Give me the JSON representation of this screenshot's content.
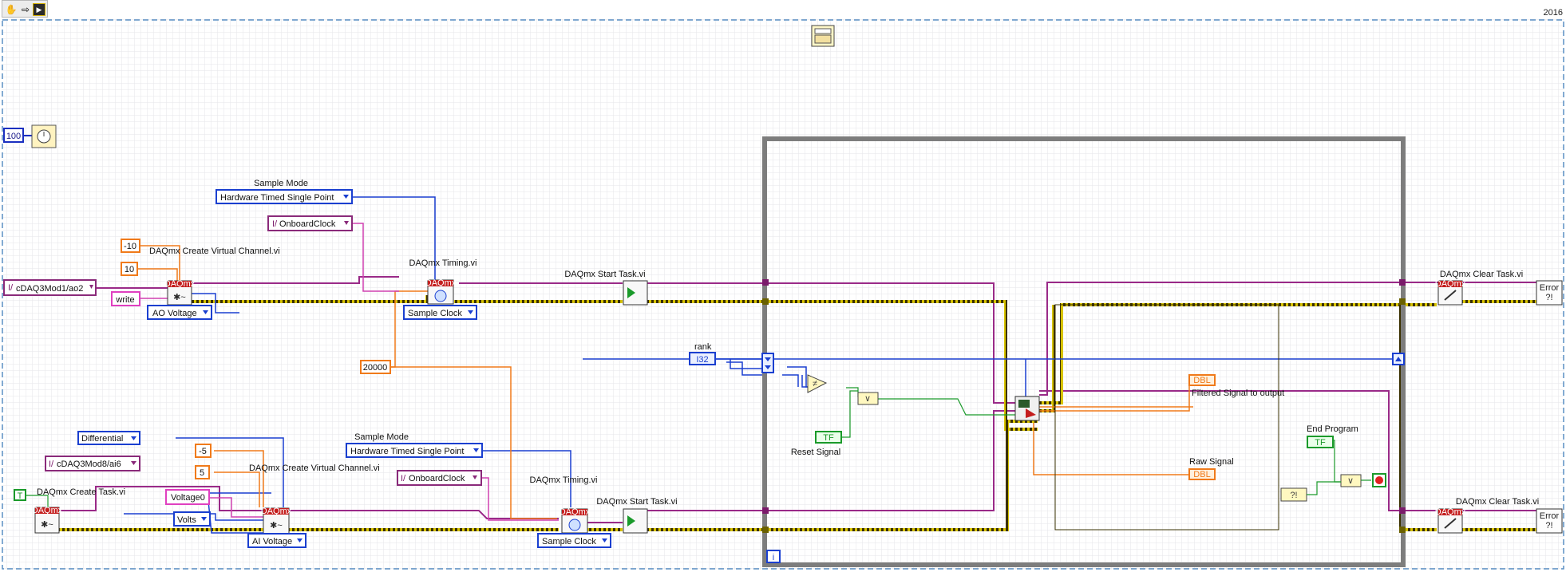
{
  "version_year": "2016",
  "toolbar": {
    "run_label": "▶",
    "highlight_icon": "⇨",
    "hand_icon": "✋"
  },
  "constants": {
    "wait_ms": "100",
    "ao_min": "-10",
    "ao_max": "10",
    "ai_min": "-5",
    "ai_max": "5",
    "rate": "20000",
    "rank_type": "I32",
    "bool_const": "T",
    "dbl_type": "DBL",
    "tf": "TF"
  },
  "channels": {
    "ao_channel": "cDAQ3Mod1/ao2",
    "ai_channel": "cDAQ3Mod8/ai6",
    "ao_clock": "OnboardClock",
    "ai_clock": "OnboardClock",
    "write_label": "write",
    "voltage_name": "Voltage0",
    "units": "Volts",
    "terminal": "Differential"
  },
  "enums": {
    "ao_voltage": "AO Voltage",
    "ai_voltage": "AI Voltage",
    "sample_clock_1": "Sample Clock",
    "sample_clock_2": "Sample Clock",
    "sample_mode_1": "Hardware Timed Single Point",
    "sample_mode_2": "Hardware Timed Single Point"
  },
  "labels": {
    "sample_mode_1": "Sample Mode",
    "sample_mode_2": "Sample Mode",
    "create_vc_1": "DAQmx Create Virtual Channel.vi",
    "create_vc_2": "DAQmx Create Virtual Channel.vi",
    "timing_1": "DAQmx Timing.vi",
    "timing_2": "DAQmx Timing.vi",
    "start_1": "DAQmx Start Task.vi",
    "start_2": "DAQmx Start Task.vi",
    "create_task": "DAQmx Create Task.vi",
    "clear_1": "DAQmx Clear Task.vi",
    "clear_2": "DAQmx Clear Task.vi",
    "rank": "rank",
    "reset_signal": "Reset Signal",
    "filtered": "Filtered Signal to output",
    "raw": "Raw Signal",
    "end_program": "End Program",
    "loop_index": "i",
    "daqmx": "DAQmx",
    "error": "Error"
  }
}
